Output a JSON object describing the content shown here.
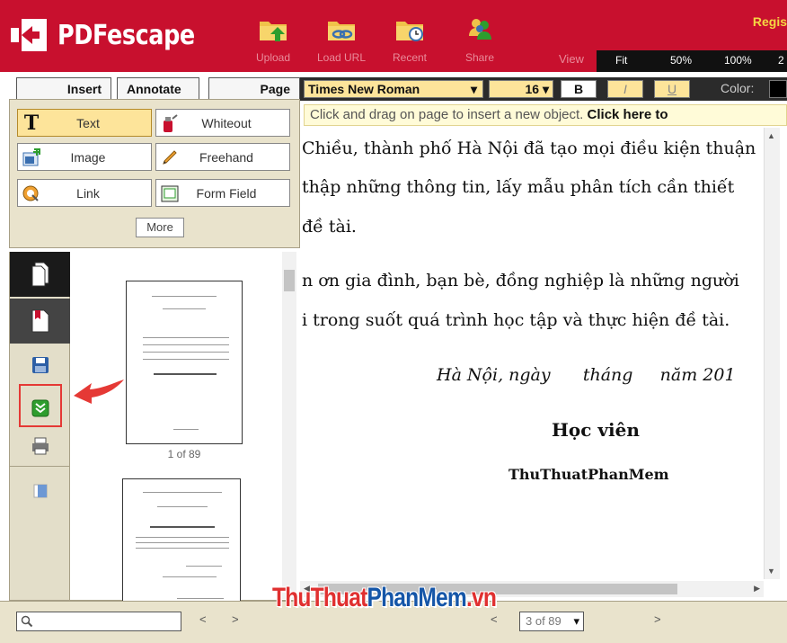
{
  "header": {
    "logo_text": "PDFescape",
    "buttons": [
      {
        "label": "Upload",
        "icon": "folder-upload-icon"
      },
      {
        "label": "Load URL",
        "icon": "folder-link-icon"
      },
      {
        "label": "Recent",
        "icon": "folder-clock-icon"
      },
      {
        "label": "Share",
        "icon": "share-users-icon"
      }
    ],
    "register": "Regis",
    "view_label": "View",
    "zoom": [
      "Fit",
      "50%",
      "100%",
      "2"
    ]
  },
  "tabs": [
    "Insert",
    "Annotate",
    "Page"
  ],
  "tools": [
    {
      "label": "Text",
      "icon": "text-tool-icon"
    },
    {
      "label": "Whiteout",
      "icon": "whiteout-icon"
    },
    {
      "label": "Image",
      "icon": "image-insert-icon"
    },
    {
      "label": "Freehand",
      "icon": "pencil-icon"
    },
    {
      "label": "Link",
      "icon": "link-icon"
    },
    {
      "label": "Form Field",
      "icon": "form-field-icon"
    }
  ],
  "more_label": "More",
  "font": {
    "family": "Times New Roman",
    "size": "16 ▾",
    "bold": "B",
    "italic": "I",
    "underline": "U",
    "color_label": "Color:"
  },
  "info_text": "Click and drag on page to insert a new object.",
  "info_link": "Click here to",
  "document": {
    "lines": [
      "Chiều, thành phố Hà Nội đã tạo mọi điều kiện thuận",
      "thập những thông tin, lấy mẫu phân tích cần thiết",
      "đề tài.",
      "n ơn gia đình, bạn bè, đồng nghiệp là những người",
      "i trong suốt quá trình học tập và thực hiện đề tài."
    ],
    "date_line": "Hà Nội, ngày      tháng     năm 201",
    "role": "Học viên",
    "signer": "ThuThuatPhanMem"
  },
  "thumbnails": {
    "page_label": "1 of 89"
  },
  "bottom": {
    "prev": "<",
    "next": ">",
    "prev2": "<",
    "next2": ">",
    "page": "3 of 89"
  },
  "watermark": {
    "a": "ThuThuat",
    "b": "PhanMem",
    "c": ".vn"
  },
  "colors": {
    "brand_red": "#c8102e",
    "accent_yellow": "#fde49a",
    "highlight_red": "#e53935"
  }
}
